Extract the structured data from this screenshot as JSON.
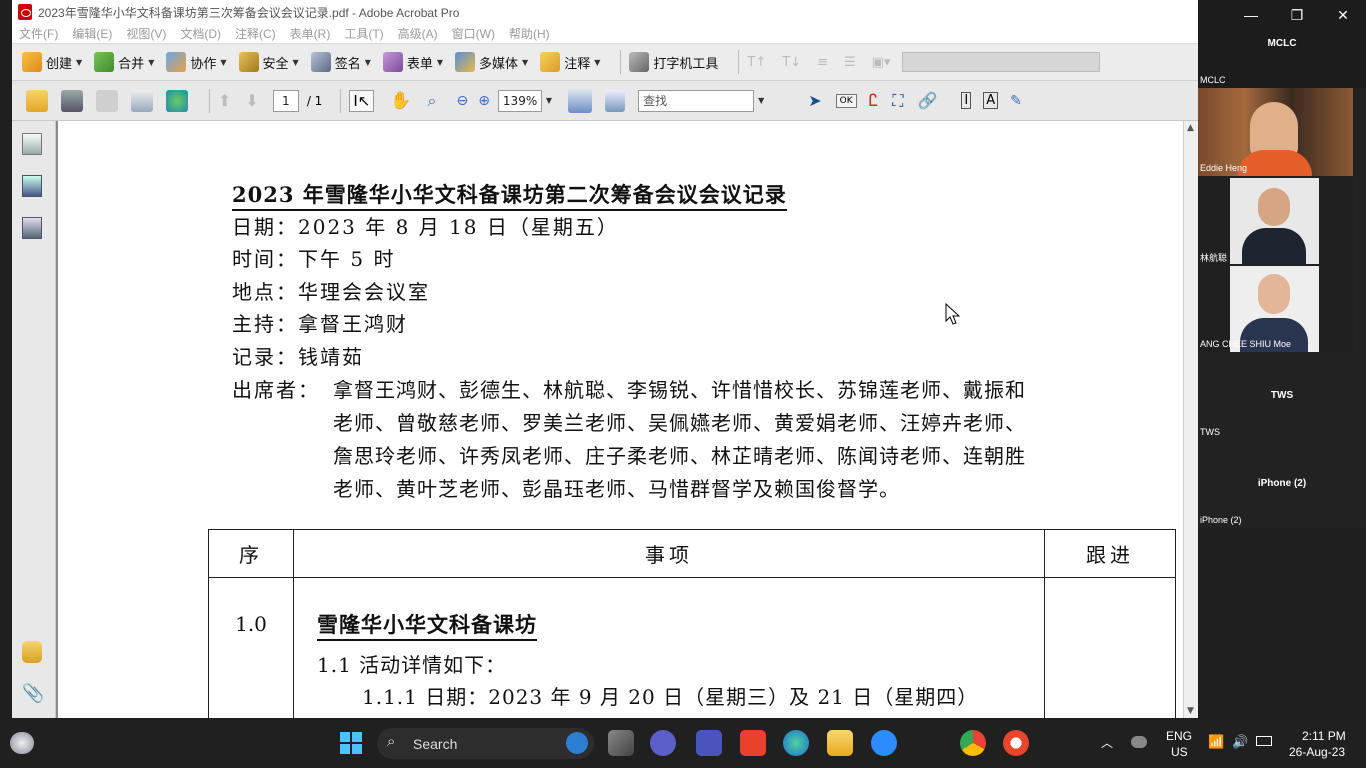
{
  "window": {
    "title": "2023年雪隆华小华文科备课坊第三次筹备会议会议记录.pdf - Adobe Acrobat Pro"
  },
  "menu": [
    "文件(F)",
    "编辑(E)",
    "视图(V)",
    "文档(D)",
    "注释(C)",
    "表单(R)",
    "工具(T)",
    "高级(A)",
    "窗口(W)",
    "帮助(H)"
  ],
  "toolbar1": {
    "create": "创建",
    "combine": "合并",
    "collaborate": "协作",
    "secure": "安全",
    "sign": "签名",
    "forms": "表单",
    "multimedia": "多媒体",
    "comment": "注释",
    "typewriter": "打字机工具"
  },
  "toolbar2": {
    "page_current": "1",
    "page_total": "/ 1",
    "zoom": "139%",
    "find_placeholder": "查找"
  },
  "document": {
    "title": "2023 年雪隆华小华文科备课坊第二次筹备会议会议记录",
    "date": "日期：2023 年 8 月 18 日（星期五）",
    "time": "时间：下午 5 时",
    "place": "地点：华理会会议室",
    "host": "主持：拿督王鸿财",
    "recorder": "记录：钱靖茹",
    "attendees_label": "出席者：",
    "attendees_lines": [
      "拿督王鸿财、彭德生、林航聪、李锡锐、许惜惜校长、苏锦莲老师、戴振和",
      "老师、曾敬慈老师、罗美兰老师、吴佩嬿老师、黄爱娟老师、汪婷卉老师、",
      "詹思玲老师、许秀凤老师、庄子柔老师、林芷晴老师、陈闻诗老师、连朝胜",
      "老师、黄叶芝老师、彭晶珏老师、马惜群督学及赖国俊督学。"
    ],
    "table": {
      "headers": [
        "序",
        "事项",
        "跟进"
      ],
      "row1_num": "1.0",
      "row1_title": "雪隆华小华文科备课坊",
      "row1_sub": "1.1 活动详情如下：",
      "row1_subsub": "1.1.1 日期：2023 年 9 月 20 日（星期三）及 21 日（星期四）"
    }
  },
  "video": {
    "tile1_center": "MCLC",
    "tile1_label": "MCLC",
    "tile2_label": "Eddie Heng",
    "tile3_label": "林航聪",
    "tile4_label": "ANG CHEE SHIU Moe",
    "tile5_center": "TWS",
    "tile5_label": "TWS",
    "tile6_center": "iPhone (2)",
    "tile6_label": "iPhone (2)"
  },
  "taskbar": {
    "search": "Search",
    "lang1": "ENG",
    "lang2": "US",
    "time": "2:11 PM",
    "date": "26-Aug-23"
  }
}
